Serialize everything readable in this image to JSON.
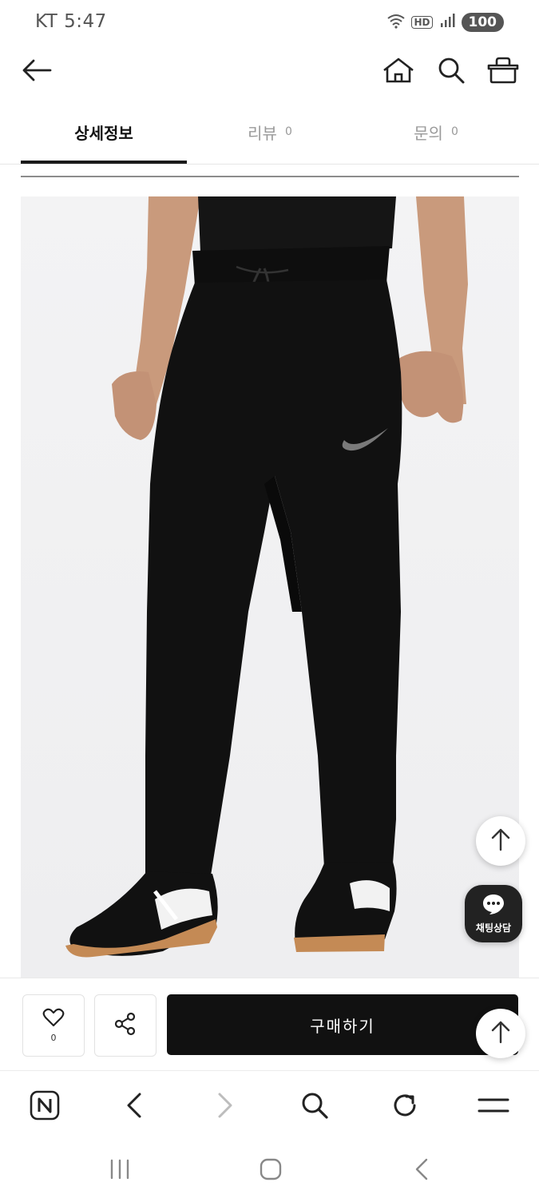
{
  "status_bar": {
    "carrier_time": "KT 5:47",
    "hd_label": "HD",
    "battery": "100"
  },
  "header": {
    "back_icon": "arrow-left-icon",
    "home_icon": "home-icon",
    "search_icon": "search-icon",
    "cart_icon": "basket-icon"
  },
  "tabs": [
    {
      "label": "상세정보",
      "count": "",
      "active": true
    },
    {
      "label": "리뷰",
      "count": "0",
      "active": false
    },
    {
      "label": "문의",
      "count": "0",
      "active": false
    }
  ],
  "chat": {
    "label": "채팅상담",
    "icon": "chat-bubble-icon"
  },
  "purchase_bar": {
    "like_count": "0",
    "like_icon": "heart-icon",
    "share_icon": "share-icon",
    "buy_label": "구매하기"
  },
  "browser_bar": {
    "icons": [
      "naver-n-icon",
      "back-chevron-icon",
      "forward-chevron-icon",
      "search-icon",
      "refresh-icon",
      "menu-icon"
    ]
  },
  "system_nav": {
    "icons": [
      "recent-apps-icon",
      "home-button-icon",
      "back-nav-icon"
    ]
  },
  "colors": {
    "buy_button": "#111111",
    "chat_button": "#222222",
    "tab_active": "#1a1a1a"
  }
}
